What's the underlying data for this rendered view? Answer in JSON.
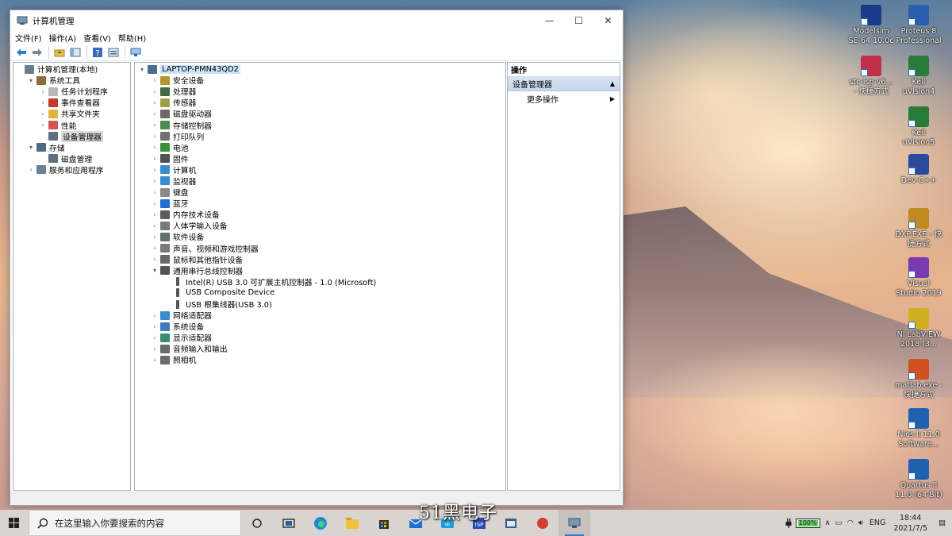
{
  "window": {
    "title": "计算机管理",
    "menu": [
      "文件(F)",
      "操作(A)",
      "查看(V)",
      "帮助(H)"
    ]
  },
  "left_tree": [
    {
      "label": "计算机管理(本地)",
      "level": 0,
      "expander": "",
      "icon": "computer-management-icon",
      "color": "#6b7c8f"
    },
    {
      "label": "系统工具",
      "level": 1,
      "expander": "▾",
      "icon": "tools-icon",
      "color": "#8a6d3b"
    },
    {
      "label": "任务计划程序",
      "level": 2,
      "expander": "›",
      "icon": "clock-icon",
      "color": "#b9b9b9"
    },
    {
      "label": "事件查看器",
      "level": 2,
      "expander": "›",
      "icon": "event-viewer-icon",
      "color": "#c0392b"
    },
    {
      "label": "共享文件夹",
      "level": 2,
      "expander": "›",
      "icon": "shared-folder-icon",
      "color": "#e2b33c"
    },
    {
      "label": "性能",
      "level": 2,
      "expander": "›",
      "icon": "performance-icon",
      "color": "#d35454"
    },
    {
      "label": "设备管理器",
      "level": 2,
      "expander": "",
      "icon": "device-manager-icon",
      "color": "#5f7180",
      "selected": true
    },
    {
      "label": "存储",
      "level": 1,
      "expander": "▾",
      "icon": "storage-icon",
      "color": "#4e6a86"
    },
    {
      "label": "磁盘管理",
      "level": 2,
      "expander": "",
      "icon": "disk-management-icon",
      "color": "#5f7180"
    },
    {
      "label": "服务和应用程序",
      "level": 1,
      "expander": "›",
      "icon": "services-icon",
      "color": "#6d7f92"
    }
  ],
  "device_tree": [
    {
      "label": "LAPTOP-PMN43QD2",
      "level": 0,
      "expander": "▾",
      "icon": "computer-icon",
      "color": "#4a6c8f",
      "highlight": true
    },
    {
      "label": "安全设备",
      "level": 1,
      "expander": "›",
      "icon": "security-device-icon",
      "color": "#b8962e"
    },
    {
      "label": "处理器",
      "level": 1,
      "expander": "›",
      "icon": "processor-icon",
      "color": "#3f6b3f"
    },
    {
      "label": "传感器",
      "level": 1,
      "expander": "›",
      "icon": "sensor-icon",
      "color": "#a0a040"
    },
    {
      "label": "磁盘驱动器",
      "level": 1,
      "expander": "›",
      "icon": "disk-drive-icon",
      "color": "#6a6a6a"
    },
    {
      "label": "存储控制器",
      "level": 1,
      "expander": "›",
      "icon": "storage-controller-icon",
      "color": "#4f8a4f"
    },
    {
      "label": "打印队列",
      "level": 1,
      "expander": "›",
      "icon": "printer-icon",
      "color": "#707070"
    },
    {
      "label": "电池",
      "level": 1,
      "expander": "›",
      "icon": "battery-icon",
      "color": "#3d8f3d"
    },
    {
      "label": "固件",
      "level": 1,
      "expander": "›",
      "icon": "firmware-icon",
      "color": "#505050"
    },
    {
      "label": "计算机",
      "level": 1,
      "expander": "›",
      "icon": "computer-icon",
      "color": "#3a8ccf"
    },
    {
      "label": "监视器",
      "level": 1,
      "expander": "›",
      "icon": "monitor-icon",
      "color": "#3a8ccf"
    },
    {
      "label": "键盘",
      "level": 1,
      "expander": "›",
      "icon": "keyboard-icon",
      "color": "#8a8a8a"
    },
    {
      "label": "蓝牙",
      "level": 1,
      "expander": "›",
      "icon": "bluetooth-icon",
      "color": "#1f6fd1"
    },
    {
      "label": "内存技术设备",
      "level": 1,
      "expander": "›",
      "icon": "memory-device-icon",
      "color": "#5c5c5c"
    },
    {
      "label": "人体学输入设备",
      "level": 1,
      "expander": "›",
      "icon": "hid-icon",
      "color": "#7a7a7a"
    },
    {
      "label": "软件设备",
      "level": 1,
      "expander": "›",
      "icon": "software-device-icon",
      "color": "#5f6f6f"
    },
    {
      "label": "声音、视频和游戏控制器",
      "level": 1,
      "expander": "›",
      "icon": "sound-icon",
      "color": "#7a7a7a"
    },
    {
      "label": "鼠标和其他指针设备",
      "level": 1,
      "expander": "›",
      "icon": "mouse-icon",
      "color": "#6a6a6a"
    },
    {
      "label": "通用串行总线控制器",
      "level": 1,
      "expander": "▾",
      "icon": "usb-controller-icon",
      "color": "#555555"
    },
    {
      "label": "Intel(R) USB 3.0 可扩展主机控制器 - 1.0 (Microsoft)",
      "level": 2,
      "expander": "",
      "icon": "usb-icon",
      "color": "#555555"
    },
    {
      "label": "USB Composite Device",
      "level": 2,
      "expander": "",
      "icon": "usb-icon",
      "color": "#555555"
    },
    {
      "label": "USB 根集线器(USB 3.0)",
      "level": 2,
      "expander": "",
      "icon": "usb-icon",
      "color": "#555555"
    },
    {
      "label": "网络适配器",
      "level": 1,
      "expander": "›",
      "icon": "network-adapter-icon",
      "color": "#3a8ccf"
    },
    {
      "label": "系统设备",
      "level": 1,
      "expander": "›",
      "icon": "system-device-icon",
      "color": "#3a7cbf"
    },
    {
      "label": "显示适配器",
      "level": 1,
      "expander": "›",
      "icon": "display-adapter-icon",
      "color": "#3a8c6f"
    },
    {
      "label": "音频输入和输出",
      "level": 1,
      "expander": "›",
      "icon": "audio-icon",
      "color": "#6a6a6a"
    },
    {
      "label": "照相机",
      "level": 1,
      "expander": "›",
      "icon": "camera-icon",
      "color": "#6a6a6a"
    }
  ],
  "actions": {
    "header": "操作",
    "section": "设备管理器",
    "item": "更多操作"
  },
  "desktop_icons": [
    {
      "label": "Modelsim SE-64 10.0c",
      "icon": "modelsim-icon",
      "color": "#1a3a8a"
    },
    {
      "label": "Proteus 8 Professional",
      "icon": "proteus-icon",
      "color": "#2a5fb0"
    },
    {
      "label": "stc-isp-v6... - 快捷方式",
      "icon": "stc-isp-icon",
      "color": "#c0304a"
    },
    {
      "label": "Keil uVision4",
      "icon": "keil4-icon",
      "color": "#2a7a3a"
    },
    {
      "label": "Keil uVision5",
      "icon": "keil5-icon",
      "color": "#2a7a3a"
    },
    {
      "label": "Dev-C++",
      "icon": "devcpp-icon",
      "color": "#2a4a9a"
    },
    {
      "label": "DXP.EXE - 快捷方式",
      "icon": "dxp-icon",
      "color": "#c08a20"
    },
    {
      "label": "Visual Studio 2019",
      "icon": "visual-studio-icon",
      "color": "#7a3ab0"
    },
    {
      "label": "NI LabVIEW 2018 (3...",
      "icon": "labview-icon",
      "color": "#d0b020"
    },
    {
      "label": "matlab.exe - 快捷方式",
      "icon": "matlab-icon",
      "color": "#d05020"
    },
    {
      "label": "Nios II 11.0 Software...",
      "icon": "nios-icon",
      "color": "#2060b0"
    },
    {
      "label": "Quartus II 11.0 (64-Bit)",
      "icon": "quartus-icon",
      "color": "#2060b0"
    }
  ],
  "taskbar": {
    "search_placeholder": "在这里输入你要搜索的内容",
    "battery": "100%",
    "lang": "ENG",
    "time": "18:44",
    "date": "2021/7/5"
  },
  "watermark": "51黑电子"
}
